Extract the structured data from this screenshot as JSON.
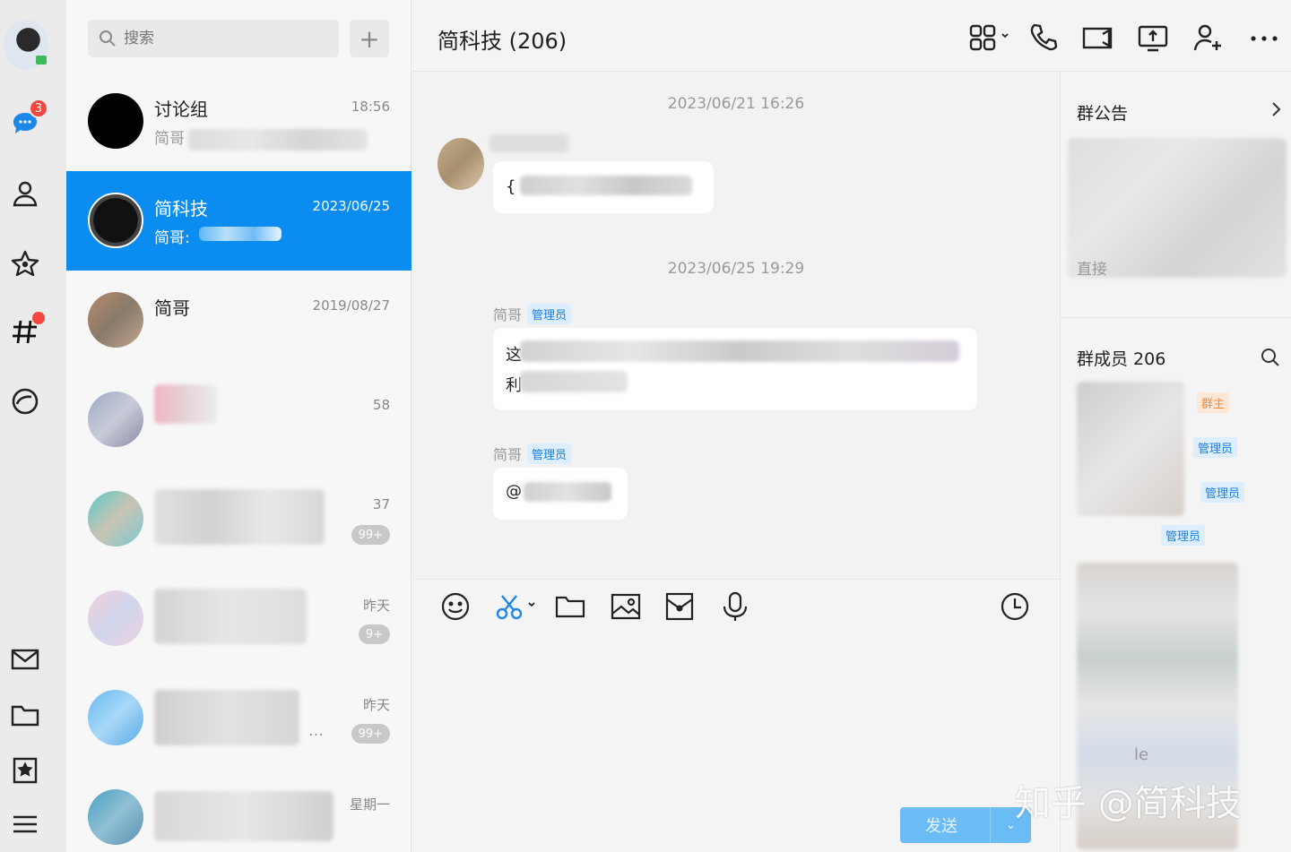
{
  "rail": {
    "chat_badge": "3"
  },
  "search": {
    "placeholder": "搜索",
    "add_label": "+"
  },
  "conversations": [
    {
      "name": "讨论组",
      "preview": "简哥",
      "time": "18:56"
    },
    {
      "name": "简科技",
      "preview": "简哥:",
      "time": "2023/06/25"
    },
    {
      "name": "简哥",
      "preview": "",
      "time": "2019/08/27"
    },
    {
      "name": "",
      "preview": "",
      "time": "58"
    },
    {
      "name": "",
      "preview": "",
      "time": "37",
      "badge": "99+"
    },
    {
      "name": "",
      "preview": "",
      "time": "昨天",
      "badge": "9+"
    },
    {
      "name": "",
      "preview": "…",
      "time": "昨天",
      "badge": "99+"
    },
    {
      "name": "",
      "preview": "",
      "time": "星期一"
    }
  ],
  "chat": {
    "title": "简科技 (206)",
    "messages": [
      {
        "timestamp": "2023/06/21 16:26",
        "text": "{"
      },
      {
        "timestamp": "2023/06/25 19:29",
        "sender": "简哥",
        "tag": "管理员",
        "text": "这",
        "text2": "利"
      },
      {
        "sender": "简哥",
        "tag": "管理员",
        "text": "@"
      }
    ],
    "send_label": "发送"
  },
  "info": {
    "notice_title": "群公告",
    "notice_partial": "直接",
    "members_title": "群成员 206",
    "member_tags": [
      "群主",
      "管理员",
      "管理员",
      "管理员"
    ],
    "member_partial": "le"
  },
  "watermark": "知乎 @简科技",
  "colors": {
    "accent": "#0a8cf0",
    "badge": "#f2473f",
    "admin_tag": "#1a7fe0",
    "owner_tag": "#f08a3c"
  }
}
